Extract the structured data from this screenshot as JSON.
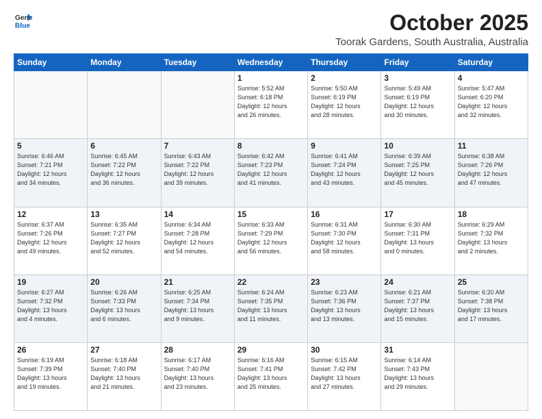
{
  "logo": {
    "line1": "General",
    "line2": "Blue"
  },
  "header": {
    "month": "October 2025",
    "location": "Toorak Gardens, South Australia, Australia"
  },
  "weekdays": [
    "Sunday",
    "Monday",
    "Tuesday",
    "Wednesday",
    "Thursday",
    "Friday",
    "Saturday"
  ],
  "weeks": [
    [
      {
        "day": "",
        "info": ""
      },
      {
        "day": "",
        "info": ""
      },
      {
        "day": "",
        "info": ""
      },
      {
        "day": "1",
        "info": "Sunrise: 5:52 AM\nSunset: 6:18 PM\nDaylight: 12 hours\nand 26 minutes."
      },
      {
        "day": "2",
        "info": "Sunrise: 5:50 AM\nSunset: 6:19 PM\nDaylight: 12 hours\nand 28 minutes."
      },
      {
        "day": "3",
        "info": "Sunrise: 5:49 AM\nSunset: 6:19 PM\nDaylight: 12 hours\nand 30 minutes."
      },
      {
        "day": "4",
        "info": "Sunrise: 5:47 AM\nSunset: 6:20 PM\nDaylight: 12 hours\nand 32 minutes."
      }
    ],
    [
      {
        "day": "5",
        "info": "Sunrise: 6:46 AM\nSunset: 7:21 PM\nDaylight: 12 hours\nand 34 minutes."
      },
      {
        "day": "6",
        "info": "Sunrise: 6:45 AM\nSunset: 7:22 PM\nDaylight: 12 hours\nand 36 minutes."
      },
      {
        "day": "7",
        "info": "Sunrise: 6:43 AM\nSunset: 7:22 PM\nDaylight: 12 hours\nand 39 minutes."
      },
      {
        "day": "8",
        "info": "Sunrise: 6:42 AM\nSunset: 7:23 PM\nDaylight: 12 hours\nand 41 minutes."
      },
      {
        "day": "9",
        "info": "Sunrise: 6:41 AM\nSunset: 7:24 PM\nDaylight: 12 hours\nand 43 minutes."
      },
      {
        "day": "10",
        "info": "Sunrise: 6:39 AM\nSunset: 7:25 PM\nDaylight: 12 hours\nand 45 minutes."
      },
      {
        "day": "11",
        "info": "Sunrise: 6:38 AM\nSunset: 7:26 PM\nDaylight: 12 hours\nand 47 minutes."
      }
    ],
    [
      {
        "day": "12",
        "info": "Sunrise: 6:37 AM\nSunset: 7:26 PM\nDaylight: 12 hours\nand 49 minutes."
      },
      {
        "day": "13",
        "info": "Sunrise: 6:35 AM\nSunset: 7:27 PM\nDaylight: 12 hours\nand 52 minutes."
      },
      {
        "day": "14",
        "info": "Sunrise: 6:34 AM\nSunset: 7:28 PM\nDaylight: 12 hours\nand 54 minutes."
      },
      {
        "day": "15",
        "info": "Sunrise: 6:33 AM\nSunset: 7:29 PM\nDaylight: 12 hours\nand 56 minutes."
      },
      {
        "day": "16",
        "info": "Sunrise: 6:31 AM\nSunset: 7:30 PM\nDaylight: 12 hours\nand 58 minutes."
      },
      {
        "day": "17",
        "info": "Sunrise: 6:30 AM\nSunset: 7:31 PM\nDaylight: 13 hours\nand 0 minutes."
      },
      {
        "day": "18",
        "info": "Sunrise: 6:29 AM\nSunset: 7:32 PM\nDaylight: 13 hours\nand 2 minutes."
      }
    ],
    [
      {
        "day": "19",
        "info": "Sunrise: 6:27 AM\nSunset: 7:32 PM\nDaylight: 13 hours\nand 4 minutes."
      },
      {
        "day": "20",
        "info": "Sunrise: 6:26 AM\nSunset: 7:33 PM\nDaylight: 13 hours\nand 6 minutes."
      },
      {
        "day": "21",
        "info": "Sunrise: 6:25 AM\nSunset: 7:34 PM\nDaylight: 13 hours\nand 9 minutes."
      },
      {
        "day": "22",
        "info": "Sunrise: 6:24 AM\nSunset: 7:35 PM\nDaylight: 13 hours\nand 11 minutes."
      },
      {
        "day": "23",
        "info": "Sunrise: 6:23 AM\nSunset: 7:36 PM\nDaylight: 13 hours\nand 13 minutes."
      },
      {
        "day": "24",
        "info": "Sunrise: 6:21 AM\nSunset: 7:37 PM\nDaylight: 13 hours\nand 15 minutes."
      },
      {
        "day": "25",
        "info": "Sunrise: 6:20 AM\nSunset: 7:38 PM\nDaylight: 13 hours\nand 17 minutes."
      }
    ],
    [
      {
        "day": "26",
        "info": "Sunrise: 6:19 AM\nSunset: 7:39 PM\nDaylight: 13 hours\nand 19 minutes."
      },
      {
        "day": "27",
        "info": "Sunrise: 6:18 AM\nSunset: 7:40 PM\nDaylight: 13 hours\nand 21 minutes."
      },
      {
        "day": "28",
        "info": "Sunrise: 6:17 AM\nSunset: 7:40 PM\nDaylight: 13 hours\nand 23 minutes."
      },
      {
        "day": "29",
        "info": "Sunrise: 6:16 AM\nSunset: 7:41 PM\nDaylight: 13 hours\nand 25 minutes."
      },
      {
        "day": "30",
        "info": "Sunrise: 6:15 AM\nSunset: 7:42 PM\nDaylight: 13 hours\nand 27 minutes."
      },
      {
        "day": "31",
        "info": "Sunrise: 6:14 AM\nSunset: 7:43 PM\nDaylight: 13 hours\nand 29 minutes."
      },
      {
        "day": "",
        "info": ""
      }
    ]
  ]
}
